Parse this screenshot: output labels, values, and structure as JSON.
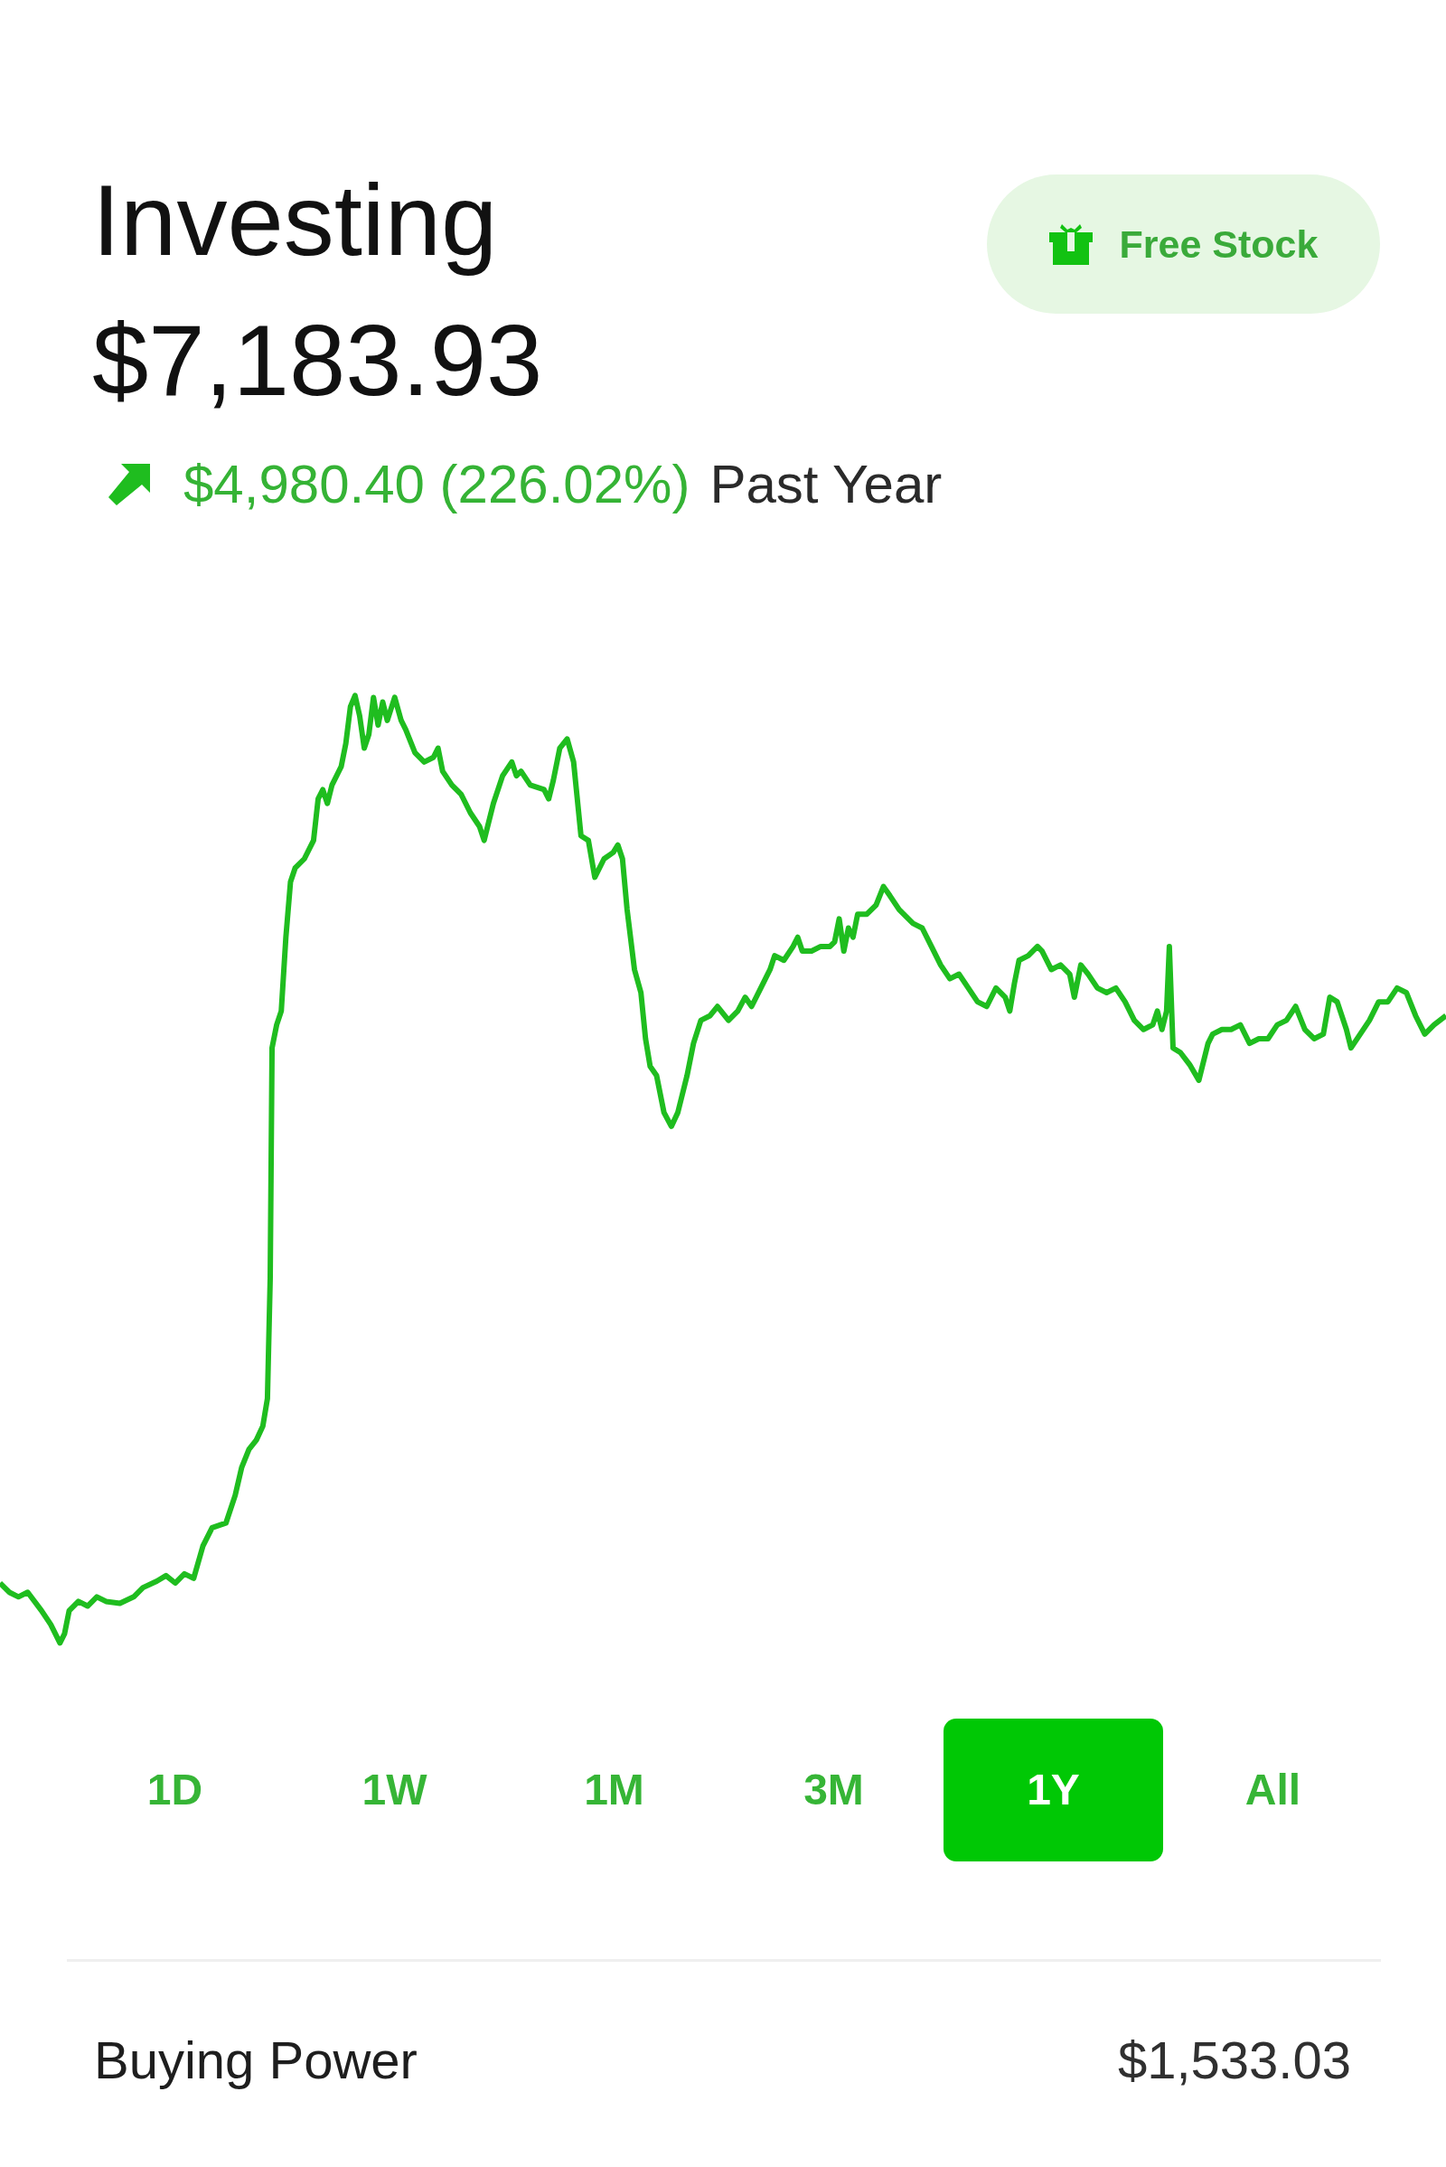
{
  "header": {
    "title": "Investing",
    "balance": "$7,183.93",
    "change": {
      "gain": true,
      "amount": "$4,980.40 (226.02%)",
      "period": "Past Year"
    }
  },
  "free_stock_button": {
    "label": "Free Stock"
  },
  "periods": [
    {
      "label": "1D",
      "selected": false
    },
    {
      "label": "1W",
      "selected": false
    },
    {
      "label": "1M",
      "selected": false
    },
    {
      "label": "3M",
      "selected": false
    },
    {
      "label": "1Y",
      "selected": true
    },
    {
      "label": "All",
      "selected": false
    }
  ],
  "buying_power": {
    "label": "Buying Power",
    "value": "$1,533.03"
  }
}
